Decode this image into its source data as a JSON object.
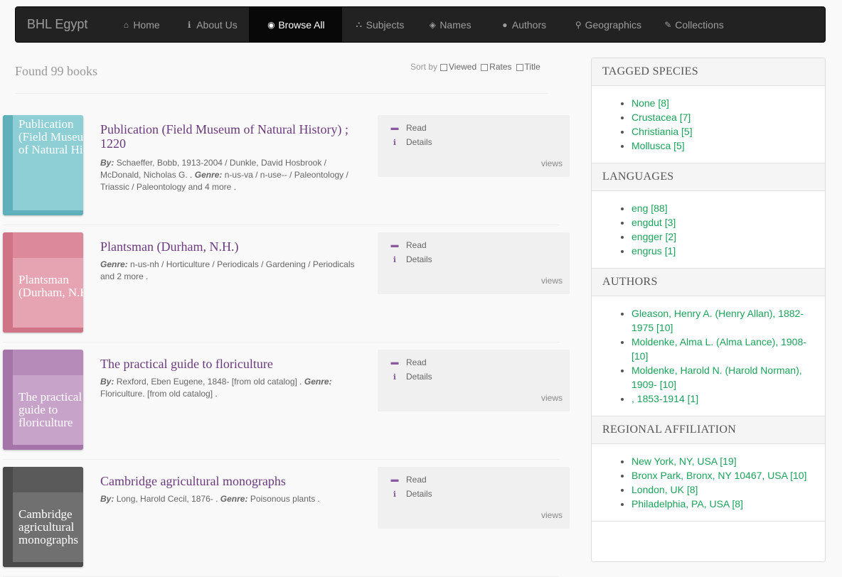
{
  "navbar": {
    "brand": "BHL Egypt",
    "items": [
      {
        "label": "Home",
        "icon": "home-icon",
        "glyph": "⌂",
        "active": false
      },
      {
        "label": "About Us",
        "icon": "info-icon",
        "glyph": "ℹ",
        "active": false
      },
      {
        "label": "Browse All",
        "icon": "globe-icon",
        "glyph": "◉",
        "active": true
      },
      {
        "label": "Subjects",
        "icon": "sitemap-icon",
        "glyph": "⛬",
        "active": false
      },
      {
        "label": "Names",
        "icon": "tags-icon",
        "glyph": "◈",
        "active": false
      },
      {
        "label": "Authors",
        "icon": "user-icon",
        "glyph": "●",
        "active": false
      },
      {
        "label": "Geographics",
        "icon": "map-marker-icon",
        "glyph": "⚲",
        "active": false
      },
      {
        "label": "Collections",
        "icon": "collection-icon",
        "glyph": "✎",
        "active": false
      }
    ]
  },
  "results": {
    "found_text": "Found 99 books",
    "sort_label": "Sort by",
    "sort_options": [
      "Viewed",
      "Rates",
      "Title"
    ]
  },
  "actions": {
    "read_label": "Read",
    "details_label": "Details",
    "views_label": "views"
  },
  "books": [
    {
      "cover_title": "Publication (Field Museum of Natural His...",
      "cover_color": "#8ecfd6",
      "band_color": "#7cc3cb",
      "spine_color": "#5fb0ba",
      "title": "Publication (Field Museum of Natural History) ; 1220",
      "by_label": "By:",
      "by_value": "Schaeffer, Bobb, 1913-2004 / Dunkle, David Hosbrook / McDonald, Nicholas G. .",
      "genre_label": "Genre:",
      "genre_value": "n-us-va / n-use-- / Paleontology / Triassic / Paleontology and 4 more ."
    },
    {
      "cover_title": "Plantsman (Durham, N.H.)",
      "cover_color": "#e6a3b1",
      "band_color": "#dc8a9b",
      "spine_color": "#cf7387",
      "title": "Plantsman (Durham, N.H.)",
      "by_label": "",
      "by_value": "",
      "genre_label": "Genre:",
      "genre_value": "n-us-nh / Horticulture / Periodicals / Gardening / Periodicals and 2 more ."
    },
    {
      "cover_title": "The practical guide to floriculture",
      "cover_color": "#c7a2c9",
      "band_color": "#b68bb9",
      "spine_color": "#a575a9",
      "title": "The practical guide to floriculture",
      "by_label": "By:",
      "by_value": "Rexford, Eben Eugene, 1848- [from old catalog] .",
      "genre_label": "Genre:",
      "genre_value": "Floriculture. [from old catalog] ."
    },
    {
      "cover_title": "Cambridge agricultural monographs",
      "cover_color": "#707070",
      "band_color": "#5a5a5a",
      "spine_color": "#4a4a4a",
      "title": "Cambridge agricultural monographs",
      "by_label": "By:",
      "by_value": "Long, Harold Cecil, 1876- .",
      "genre_label": "Genre:",
      "genre_value": "Poisonous plants ."
    }
  ],
  "sidebar": {
    "panels": [
      {
        "heading": "TAGGED SPECIES",
        "items": [
          "None [8]",
          "Crustacea [7]",
          "Christiania [5]",
          "Mollusca [5]"
        ]
      },
      {
        "heading": "LANGUAGES",
        "items": [
          "eng [88]",
          "engdut [3]",
          "engger [2]",
          "engrus [1]"
        ]
      },
      {
        "heading": "AUTHORS",
        "items": [
          "Gleason, Henry A. (Henry Allan), 1882-1975 [10]",
          "Moldenke, Alma L. (Alma Lance), 1908- [10]",
          "Moldenke, Harold N. (Harold Norman), 1909- [10]",
          ", 1853-1914 [1]"
        ]
      },
      {
        "heading": "REGIONAL AFFILIATION",
        "items": [
          "New York, NY, USA [19]",
          "Bronx Park, Bronx, NY 10467, USA [10]",
          "London, UK [8]",
          "Philadelphia, PA, USA [8]"
        ]
      }
    ]
  }
}
